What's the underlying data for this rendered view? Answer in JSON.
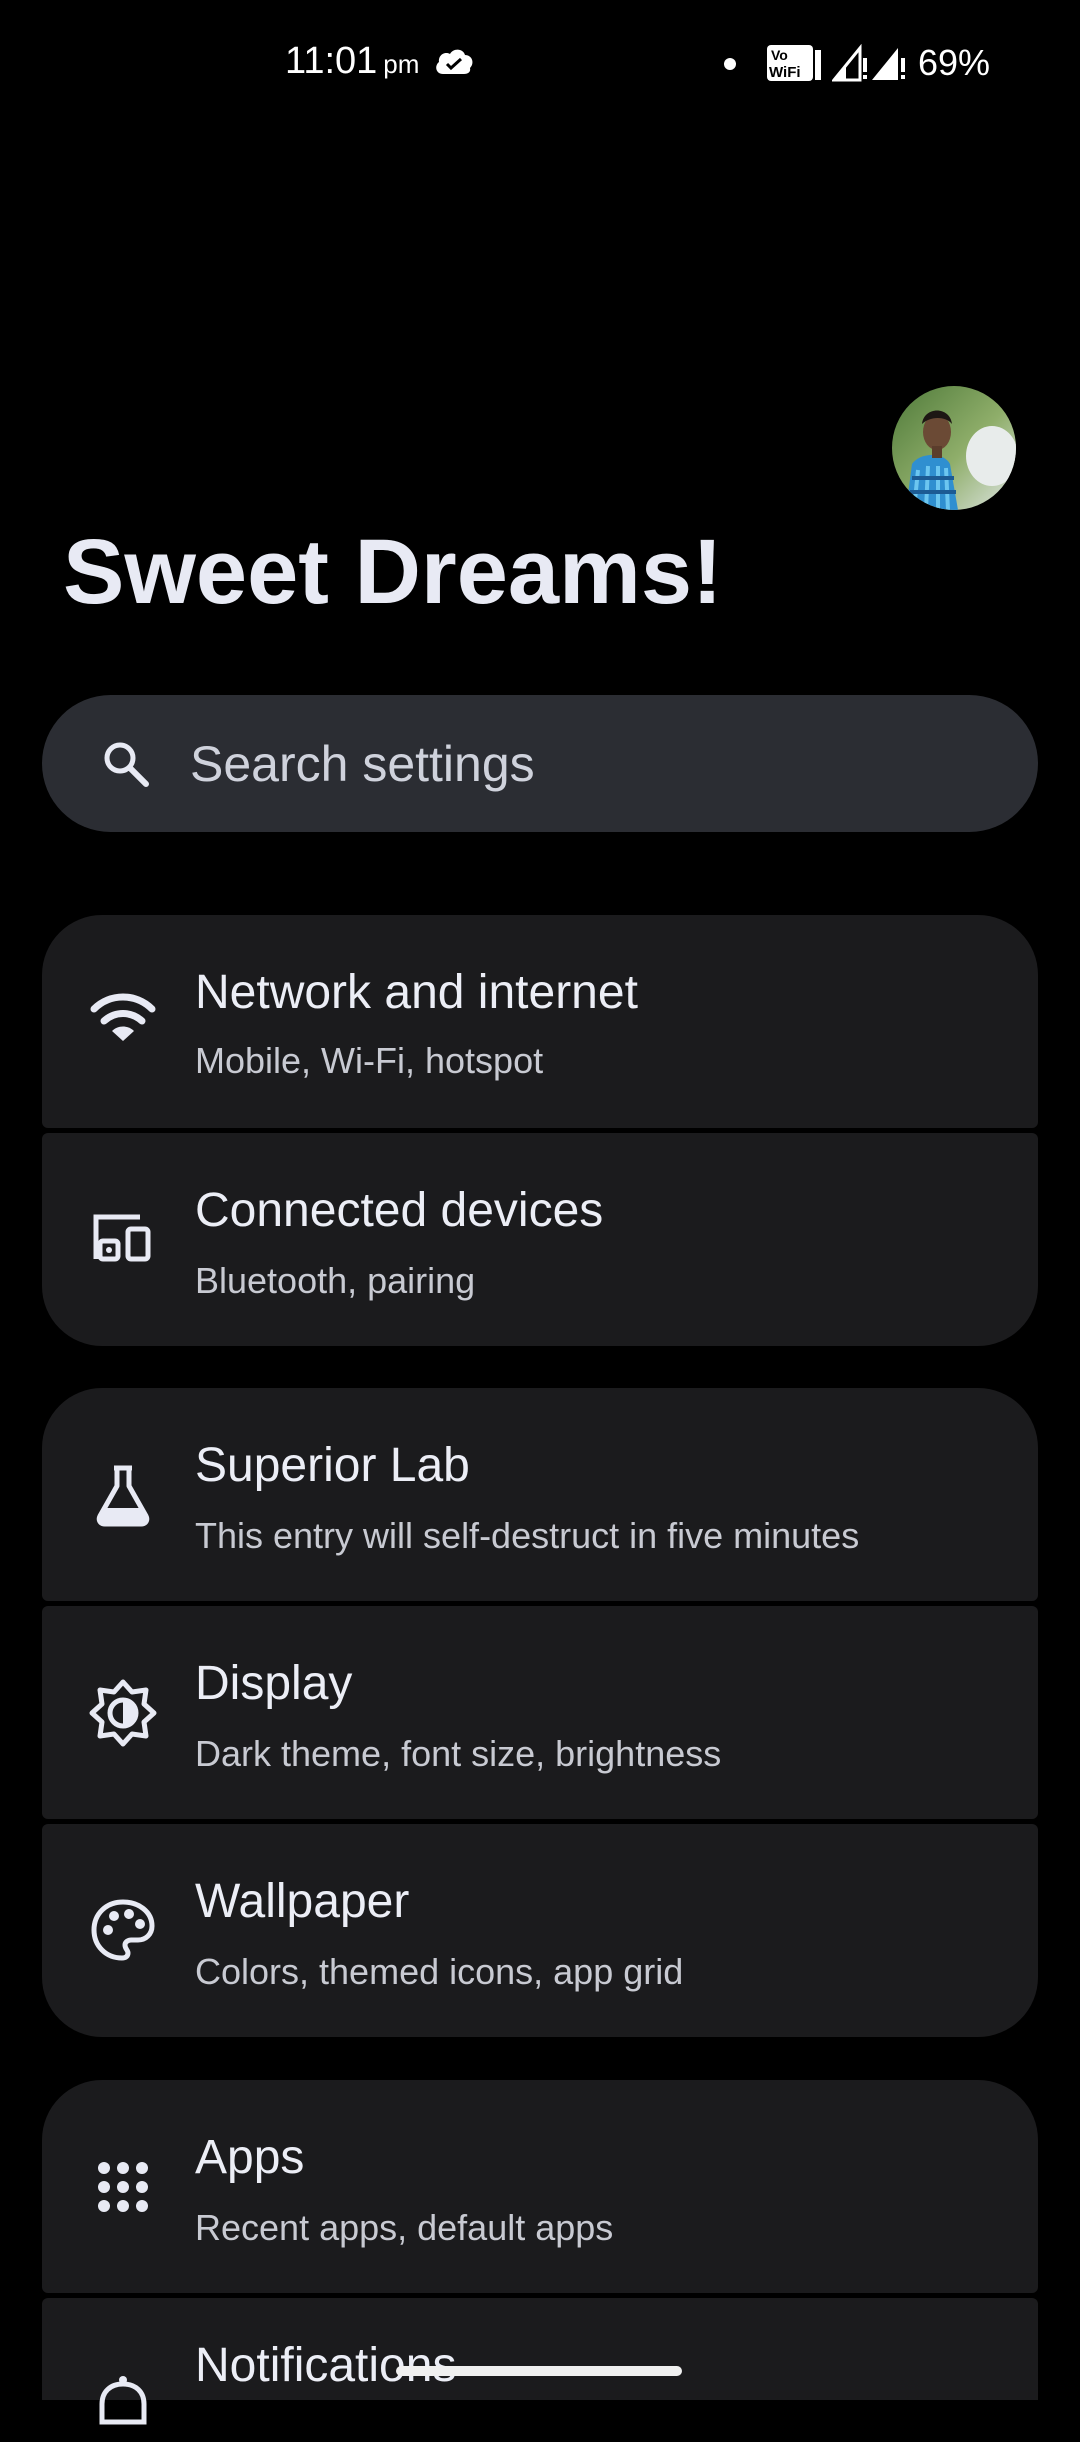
{
  "status_bar": {
    "time": "11:01",
    "ampm": "pm",
    "battery": "69%",
    "icons": [
      "cloud-icon",
      "dot-icon",
      "vowifi-icon",
      "signal-icon",
      "signal-icon"
    ]
  },
  "header": {
    "greeting": "Sweet Dreams!",
    "avatar": "profile-avatar"
  },
  "search": {
    "placeholder": "Search settings"
  },
  "settings": [
    {
      "title": "Network and internet",
      "subtitle": "Mobile, Wi-Fi, hotspot",
      "icon": "wifi-icon"
    },
    {
      "title": "Connected devices",
      "subtitle": "Bluetooth, pairing",
      "icon": "devices-icon"
    },
    {
      "title": "Superior Lab",
      "subtitle": "This entry will self-destruct in five minutes",
      "icon": "flask-icon"
    },
    {
      "title": "Display",
      "subtitle": "Dark theme, font size, brightness",
      "icon": "brightness-icon"
    },
    {
      "title": "Wallpaper",
      "subtitle": "Colors, themed icons, app grid",
      "icon": "palette-icon"
    },
    {
      "title": "Apps",
      "subtitle": "Recent apps, default apps",
      "icon": "apps-grid-icon"
    },
    {
      "title": "Notifications",
      "subtitle": "",
      "icon": "bell-icon"
    }
  ],
  "colors": {
    "background": "#000000",
    "card": "#1b1b1d",
    "search_bar": "#2b2d33",
    "text_primary": "#eceef6",
    "text_secondary": "#c8cad2"
  }
}
